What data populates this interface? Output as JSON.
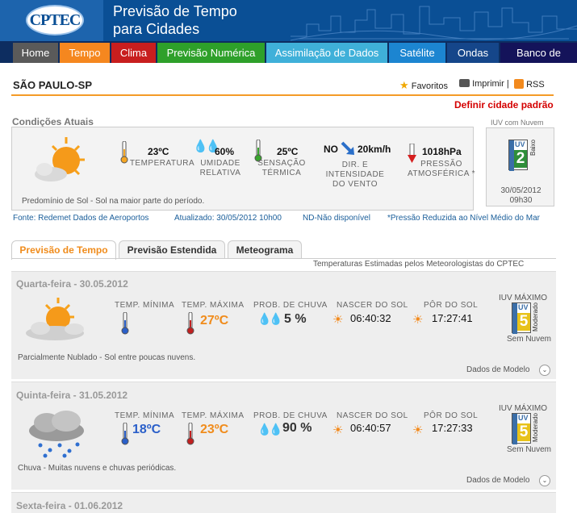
{
  "header": {
    "logo_text": "CPTEC",
    "title_line1": "Previsão de Tempo",
    "title_line2": "para Cidades"
  },
  "nav": {
    "items": [
      {
        "label": "Home",
        "color": "#5a5a5a"
      },
      {
        "label": "Tempo",
        "color": "#f5871f"
      },
      {
        "label": "Clima",
        "color": "#c81e1e"
      },
      {
        "label": "Previsão Numérica",
        "color": "#2ea02a"
      },
      {
        "label": "Assimilação de Dados",
        "color": "#3fb0d9"
      },
      {
        "label": "Satélite",
        "color": "#1c85d1"
      },
      {
        "label": "Ondas",
        "color": "#15468a"
      },
      {
        "label": "Banco de Dados",
        "color": "#14135a"
      }
    ]
  },
  "city": "SÃO PAULO-SP",
  "tools": {
    "favoritos": "Favoritos",
    "imprimir": "Imprimir",
    "rss": "RSS"
  },
  "default_city": "Definir cidade padrão",
  "current": {
    "section_title": "Condições Atuais",
    "description": "Predomínio de Sol - Sol na maior parte do período.",
    "temperature": {
      "value": "23ºC",
      "label": "TEMPERATURA"
    },
    "humidity": {
      "value": "60%",
      "label1": "UMIDADE",
      "label2": "RELATIVA"
    },
    "feels_like": {
      "value": "25ºC",
      "label1": "SENSAÇÃO",
      "label2": "TÉRMICA"
    },
    "wind": {
      "dir": "NO",
      "speed": "20km/h",
      "label1": "DIR. E",
      "label2": "INTENSIDADE",
      "label3": "DO VENTO"
    },
    "pressure": {
      "value": "1018hPa",
      "label1": "PRESSÃO",
      "label2": "ATMOSFÉRICA *"
    },
    "uv_title": "IUV com Nuvem",
    "uv": {
      "index_word": "ÍNDICE",
      "uv": "UV",
      "value": "2",
      "level": "Baixo"
    },
    "uv_date": "30/05/2012",
    "uv_time": "09h30"
  },
  "footer": {
    "source": "Fonte: Redemet Dados de Aeroportos",
    "updated": "Atualizado: 30/05/2012 10h00",
    "nd": "ND-Não disponível",
    "pressure_note": "*Pressão Reduzida ao Nível Médio do Mar"
  },
  "forecast_tabs": [
    "Previsão de Tempo",
    "Previsão Estendida",
    "Meteograma"
  ],
  "forecast_note": "Temperaturas Estimadas pelos Meteorologistas do CPTEC",
  "labels": {
    "tmin": "TEMP. MÍNIMA",
    "tmax": "TEMP. MÁXIMA",
    "rain": "PROB. DE CHUVA",
    "sunrise": "NASCER DO SOL",
    "sunset": "PÔR DO SOL",
    "uv_max": "IUV MÁXIMO",
    "uv_cloud": "Sem Nuvem",
    "model_data": "Dados de Modelo"
  },
  "days": [
    {
      "title": "Quarta-feira - 30.05.2012",
      "tmin": "",
      "tmax": "27ºC",
      "rain": "5 %",
      "sunrise": "06:40:32",
      "sunset": "17:27:41",
      "description": "Parcialmente Nublado - Sol entre poucas nuvens.",
      "uv": {
        "index_word": "ÍNDICE",
        "uv": "UV",
        "value": "5",
        "level": "Moderado"
      }
    },
    {
      "title": "Quinta-feira - 31.05.2012",
      "tmin": "18ºC",
      "tmax": "23ºC",
      "rain": "90 %",
      "sunrise": "06:40:57",
      "sunset": "17:27:33",
      "description": "Chuva - Muitas nuvens e chuvas periódicas.",
      "uv": {
        "index_word": "ÍNDICE",
        "uv": "UV",
        "value": "5",
        "level": "Moderado"
      }
    },
    {
      "title": "Sexta-feira - 01.06.2012"
    }
  ]
}
